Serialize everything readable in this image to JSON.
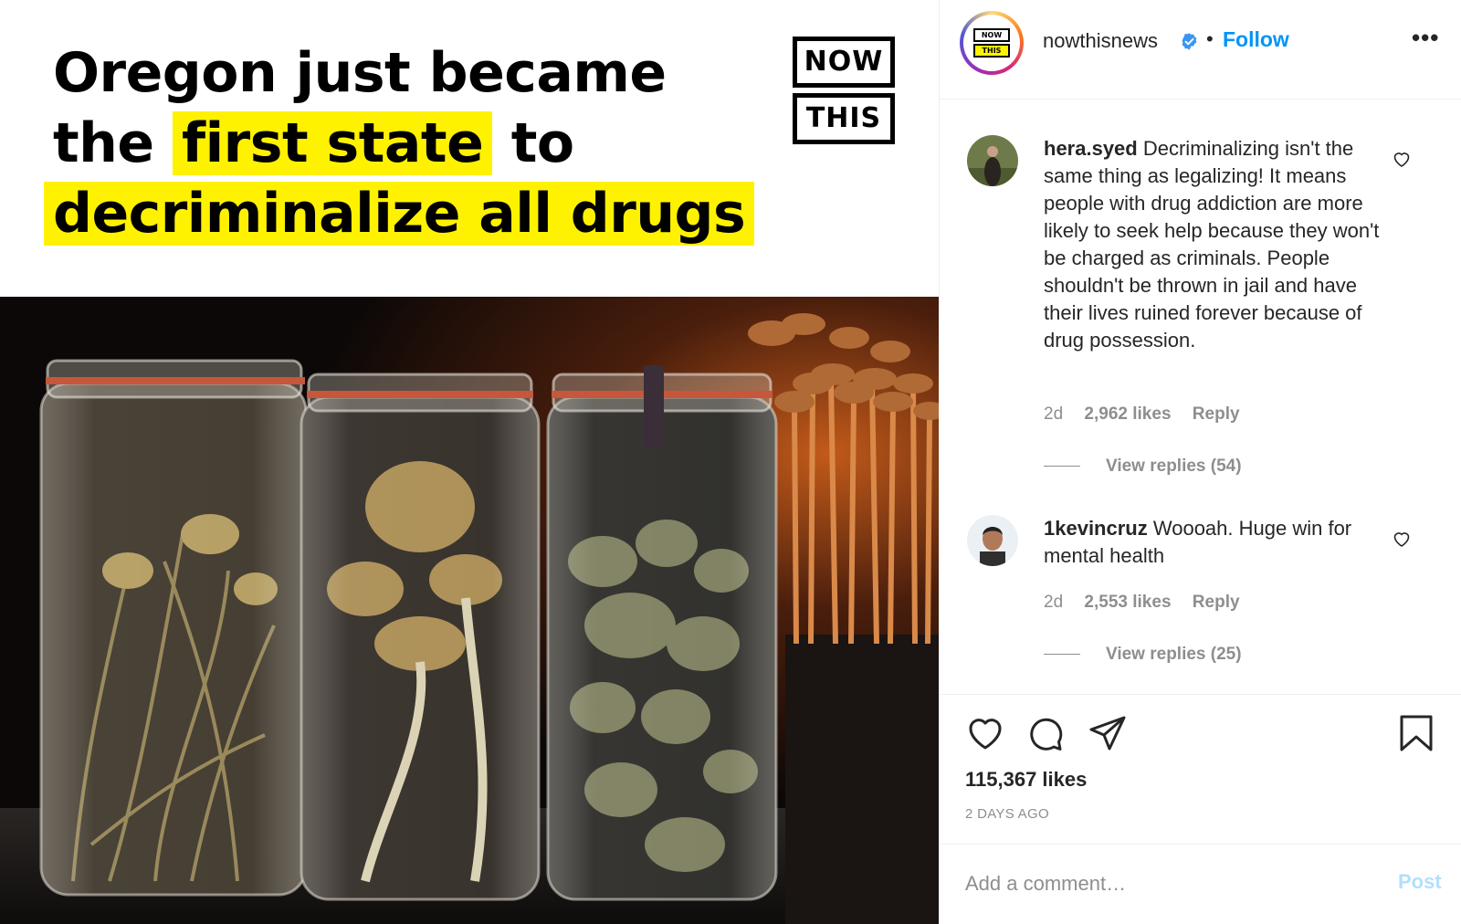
{
  "post": {
    "headline": {
      "line1": "Oregon just became",
      "line2_before": "the",
      "line2_highlight": "first state",
      "line2_after": "to",
      "line3_highlight": "decriminalize all drugs"
    },
    "brand_logo": {
      "top": "NOW",
      "bottom": "THIS"
    },
    "photo_icon": "mushroom-jars-photo",
    "colors": {
      "highlight": "#fff200",
      "headline": "#000000"
    }
  },
  "header": {
    "username": "nowthisnews",
    "verified_icon": "verified-badge-icon",
    "separator": "•",
    "follow_label": "Follow",
    "more_label": "•••",
    "avatar_logo": {
      "top": "NOW",
      "bottom": "THIS"
    }
  },
  "comments": [
    {
      "user": "hera.syed",
      "text": "Decriminalizing isn't the same thing as legalizing! It means people with drug addiction are more likely to seek help because they won't be charged as criminals. People shouldn't be thrown in jail and have their lives ruined forever because of drug possession.",
      "age": "2d",
      "likes": "2,962 likes",
      "reply_label": "Reply",
      "view_replies": "View replies (54)"
    },
    {
      "user": "1kevincruz",
      "text": "Woooah. Huge win for mental health",
      "age": "2d",
      "likes": "2,553 likes",
      "reply_label": "Reply",
      "view_replies": "View replies (25)"
    }
  ],
  "actions": {
    "icons": [
      "heart-icon",
      "comment-icon",
      "share-icon",
      "bookmark-icon"
    ],
    "likes": "115,367 likes",
    "date": "2 DAYS AGO"
  },
  "add_comment": {
    "placeholder": "Add a comment…",
    "post_label": "Post"
  },
  "colors": {
    "link": "#0095f6",
    "muted": "#8e8e8e",
    "text": "#262626",
    "post_disabled": "#b2dffc"
  }
}
